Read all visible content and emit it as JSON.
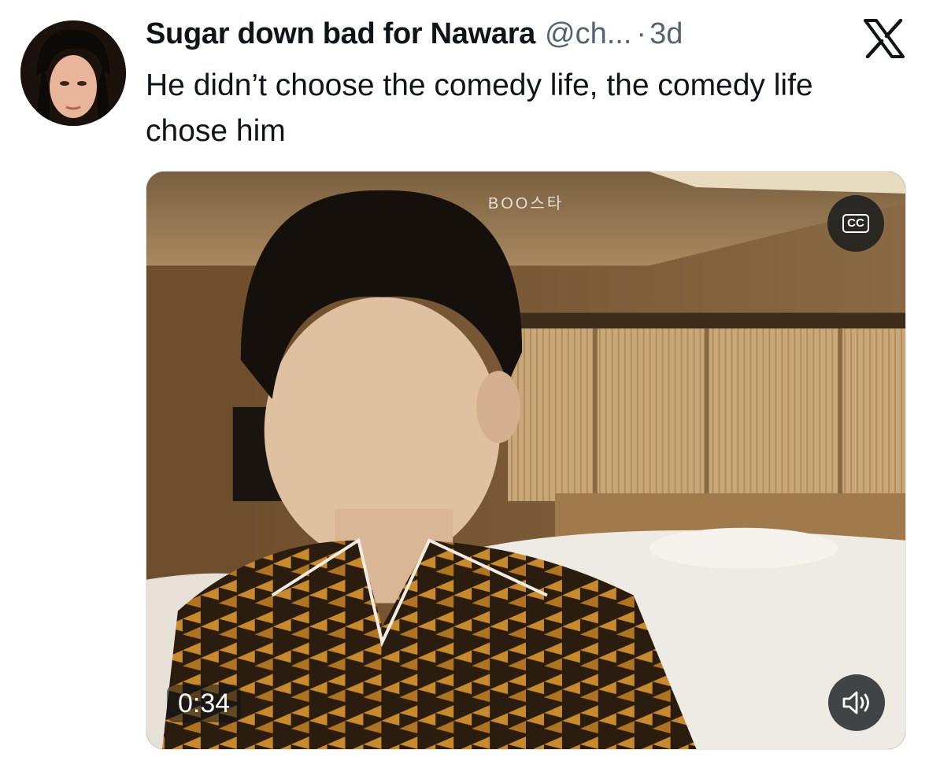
{
  "tweet": {
    "author_name": "Sugar down bad for Nawara",
    "author_handle": "@ch...",
    "separator": "·",
    "timestamp": "3d",
    "text": "He didn’t choose the comedy life, the comedy life chose him"
  },
  "icons": {
    "platform_logo": "x-logo-icon",
    "captions": "closed-captions-icon",
    "volume": "speaker-muted-icon"
  },
  "media": {
    "type": "video",
    "watermark": "BOO스타",
    "duration": "0:34",
    "cc_label": "CC"
  },
  "colors": {
    "text_primary": "#0f1419",
    "text_secondary": "#536471",
    "overlay": "#0f1419"
  }
}
